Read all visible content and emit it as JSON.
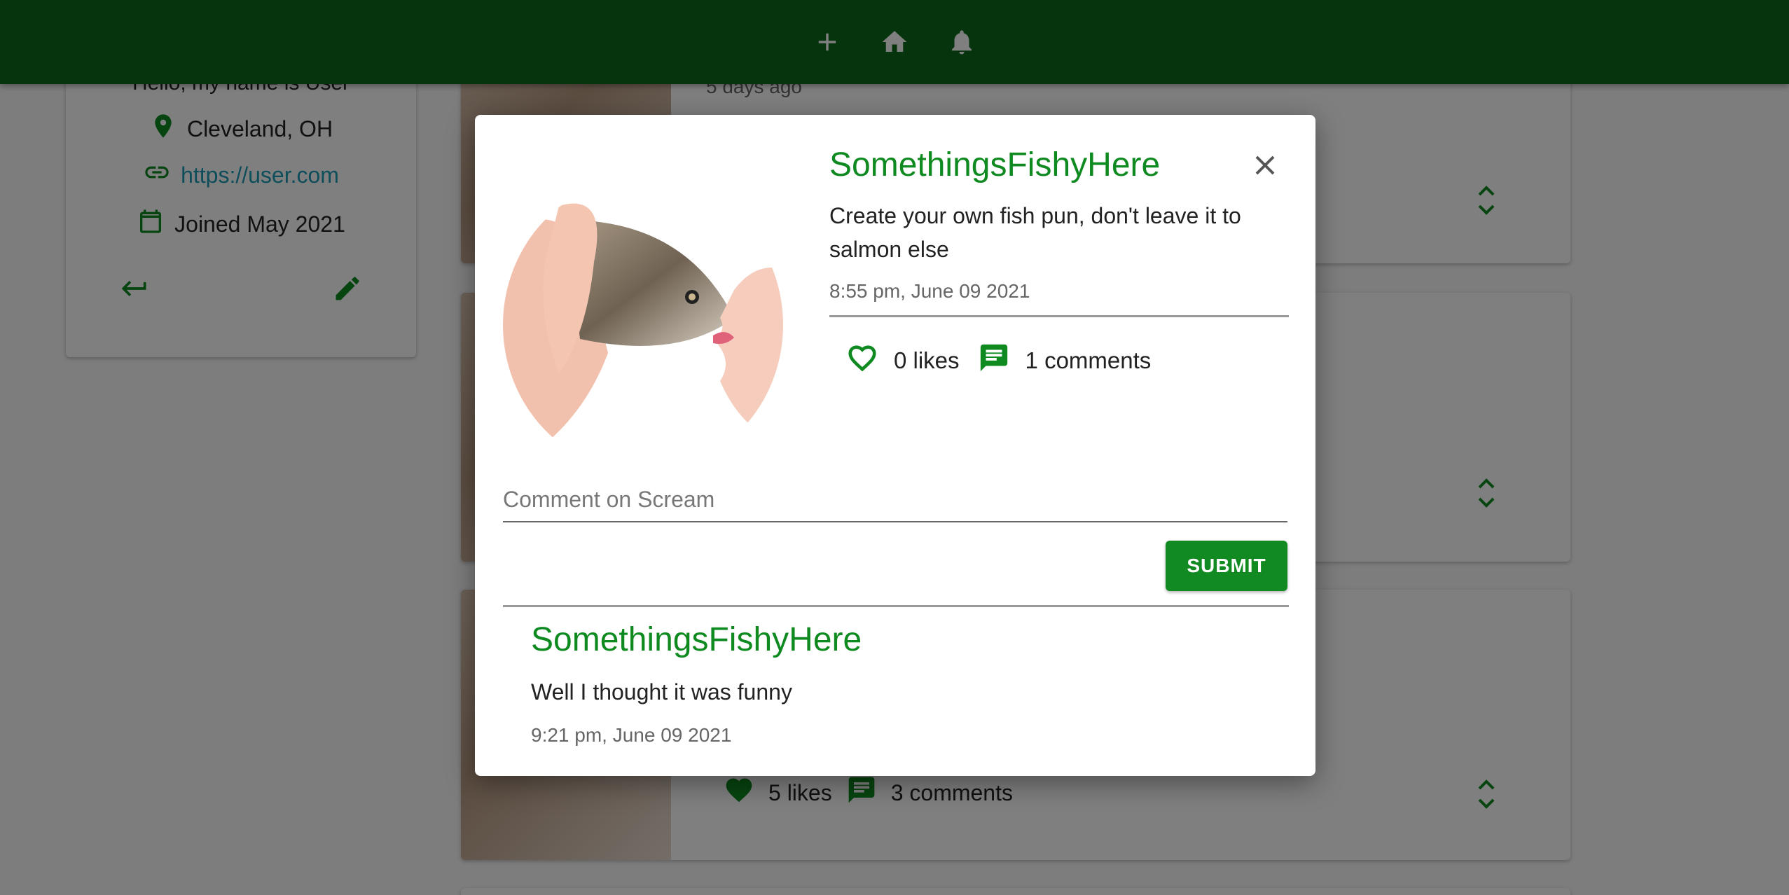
{
  "appbar": {
    "icons": [
      "add-icon",
      "home-icon",
      "notifications-icon"
    ],
    "color": "#0d6b1a"
  },
  "profile": {
    "bio": "Hello, my name is User",
    "location": "Cleveland, OH",
    "website": "https://user.com",
    "joined": "Joined May 2021"
  },
  "feed": [
    {
      "time": "5 days ago"
    },
    {},
    {
      "likes": "5 likes",
      "comments": "3 comments"
    }
  ],
  "dialog": {
    "scream": {
      "user": "SomethingsFishyHere",
      "body": "Create your own fish pun, don't leave it to salmon else",
      "date": "8:55 pm, June 09 2021",
      "likes": "0 likes",
      "comments": "1 comments"
    },
    "comment_form": {
      "placeholder": "Comment on Scream",
      "value": "",
      "submit_label": "SUBMIT"
    },
    "comments": [
      {
        "user": "SomethingsFishyHere",
        "body": "Well I thought it was funny",
        "date": "9:21 pm, June 09 2021"
      }
    ]
  },
  "colors": {
    "accent": "#0f8a20",
    "link": "#1a9cb5",
    "appbar": "#0d6b1a"
  }
}
